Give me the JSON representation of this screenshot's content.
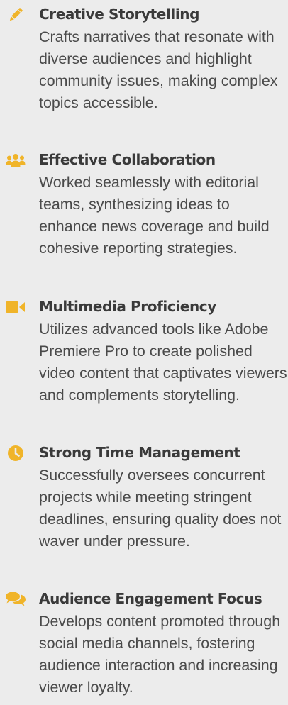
{
  "theme": {
    "background": "#ececec",
    "icon_accent": "#f0b429"
  },
  "skills": [
    {
      "icon": "pencil-icon",
      "title": "Creative Storytelling",
      "description": "Crafts narratives that resonate with diverse audiences and highlight community issues, making complex topics accessible."
    },
    {
      "icon": "users-icon",
      "title": "Effective Collaboration",
      "description": "Worked seamlessly with editorial teams, synthesizing ideas to enhance news coverage and build cohesive reporting strategies."
    },
    {
      "icon": "video-camera-icon",
      "title": "Multimedia Proficiency",
      "description": "Utilizes advanced tools like Adobe Premiere Pro to create polished video content that captivates viewers and complements storytelling."
    },
    {
      "icon": "clock-icon",
      "title": "Strong Time Management",
      "description": "Successfully oversees concurrent projects while meeting stringent deadlines, ensuring quality does not waver under pressure."
    },
    {
      "icon": "comments-icon",
      "title": "Audience Engagement Focus",
      "description": "Develops content promoted through social media channels, fostering audience interaction and increasing viewer loyalty."
    }
  ]
}
